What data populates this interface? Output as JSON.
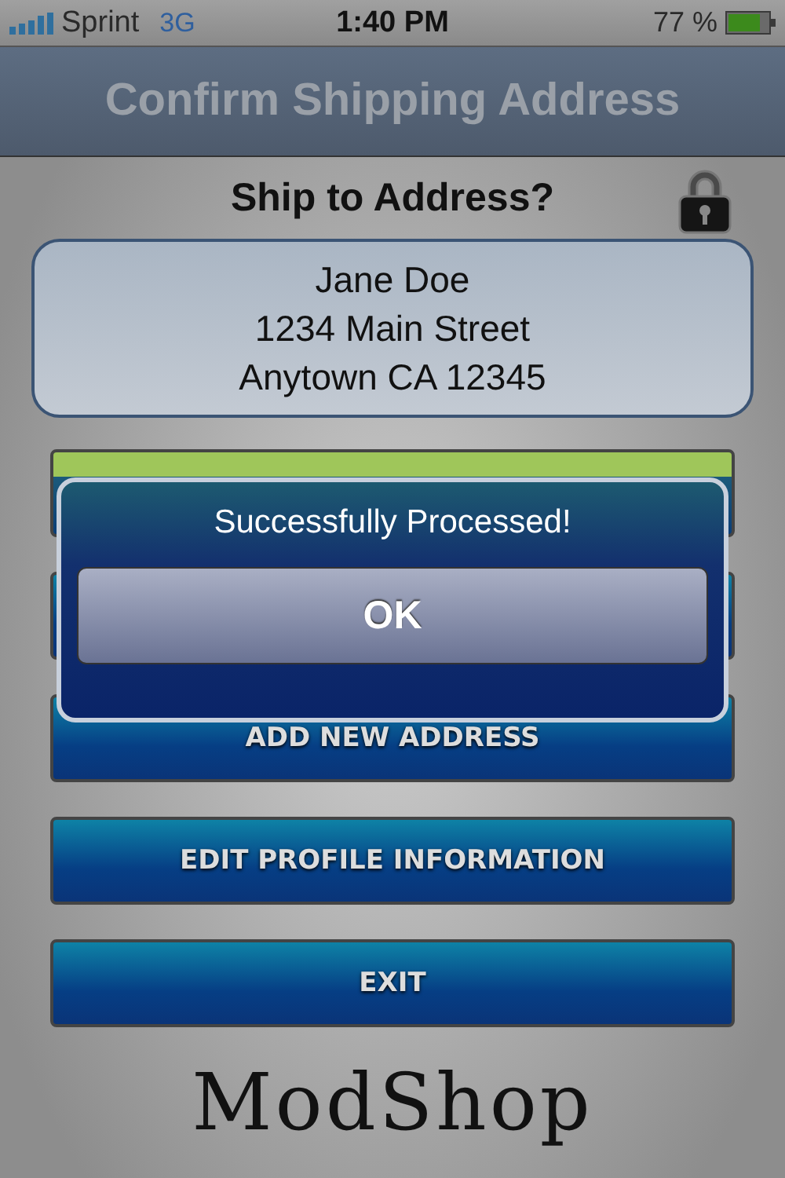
{
  "status_bar": {
    "carrier": "Sprint",
    "network": "3G",
    "time": "1:40 PM",
    "battery": "77 %"
  },
  "nav_bar": {
    "title": "Confirm Shipping Address"
  },
  "heading": "Ship to Address?",
  "address": [
    "Jane Doe",
    "1234 Main Street",
    "Anytown  CA  12345"
  ],
  "buttons": [
    {
      "kind": "confirm"
    },
    {
      "kind": "action"
    },
    {
      "label": "ADD NEW ADDRESS",
      "kind": "action"
    },
    {
      "label": "EDIT PROFILE INFORMATION",
      "kind": "action"
    },
    {
      "label": "EXIT",
      "kind": "action"
    }
  ],
  "alert": {
    "message": "Successfully Processed!",
    "button": "OK"
  },
  "logo": "ModShop"
}
